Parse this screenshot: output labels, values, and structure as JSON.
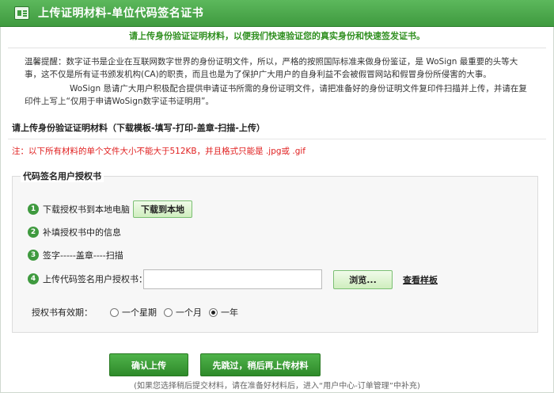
{
  "header": {
    "title": "上传证明材料-单位代码签名证书",
    "icon": "id-card-icon"
  },
  "intro": {
    "headline": "请上传身份验证证明材料，以便我们快速验证您的真实身份和快速签发证书。",
    "paragraph1": "温馨提醒：数字证书是企业在互联网数字世界的身份证明文件，所以，严格的按照国际标准来做身份鉴证，是 WoSign 最重要的头等大事，这不仅是所有证书颁发机构(CA)的职责，而且也是为了保护广大用户的自身利益不会被假冒网站和假冒身份所侵害的大事。",
    "paragraph2": "WoSign 恳请广大用户积极配合提供申请证书所需的身份证明文件，请把准备好的身份证明文件复印件扫描并上传，并请在复印件上写上“仅用于申请WoSign数字证书证明用”。"
  },
  "section": {
    "title": "请上传身份验证证明材料（下载模板-填写-打印-盖章-扫描-上传）",
    "note": "注：以下所有材料的单个文件大小不能大于512KB，并且格式只能是 .jpg或 .gif"
  },
  "auth_form": {
    "legend": "代码签名用户授权书",
    "steps": [
      {
        "num": "1",
        "label": "下载授权书到本地电脑"
      },
      {
        "num": "2",
        "label": "补填授权书中的信息"
      },
      {
        "num": "3",
        "label": "签字-----盖章----扫描"
      },
      {
        "num": "4",
        "label": "上传代码签名用户授权书："
      }
    ],
    "download_button": "下载到本地",
    "file_value": "",
    "browse_button": "浏览...",
    "view_sample": "查看样板",
    "validity_label": "授权书有效期：",
    "validity_options": [
      "一个星期",
      "一个月",
      "一年"
    ],
    "validity_selected": "一年"
  },
  "actions": {
    "confirm": "确认上传",
    "skip": "先跳过，稍后再上传材料",
    "footnote": "(如果您选择稍后提交材料，请在准备好材料后，进入“用户中心-订单管理”中补充)"
  },
  "colors": {
    "header_green": "#4aa84a",
    "accent_green": "#2f8f1f",
    "warning_red": "#e02020"
  }
}
